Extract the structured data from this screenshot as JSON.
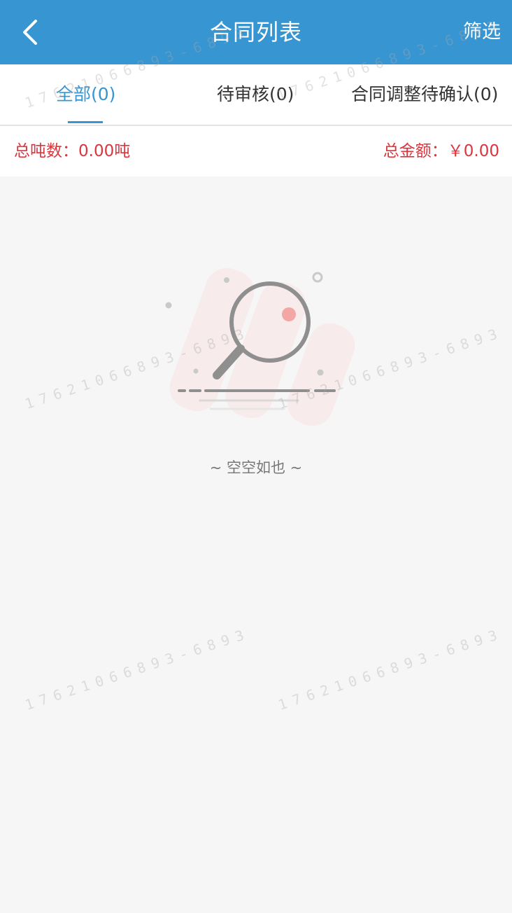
{
  "header": {
    "title": "合同列表",
    "back_icon": "chevron-left-icon",
    "filter_label": "筛选"
  },
  "tabs": [
    {
      "label": "全部(0)",
      "active": true
    },
    {
      "label": "待审核(0)",
      "active": false
    },
    {
      "label": "合同调整待确认(0)",
      "active": false
    }
  ],
  "summary": {
    "total_tons": "总吨数：0.00吨",
    "total_amount": "总金额：￥0.00"
  },
  "empty": {
    "icon": "magnifier-empty-icon",
    "text": "~ 空空如也 ~"
  },
  "watermark": {
    "text": "17621066893-6893"
  },
  "colors": {
    "primary": "#3795d2",
    "accent_red": "#d9363e",
    "background": "#f6f6f7"
  }
}
